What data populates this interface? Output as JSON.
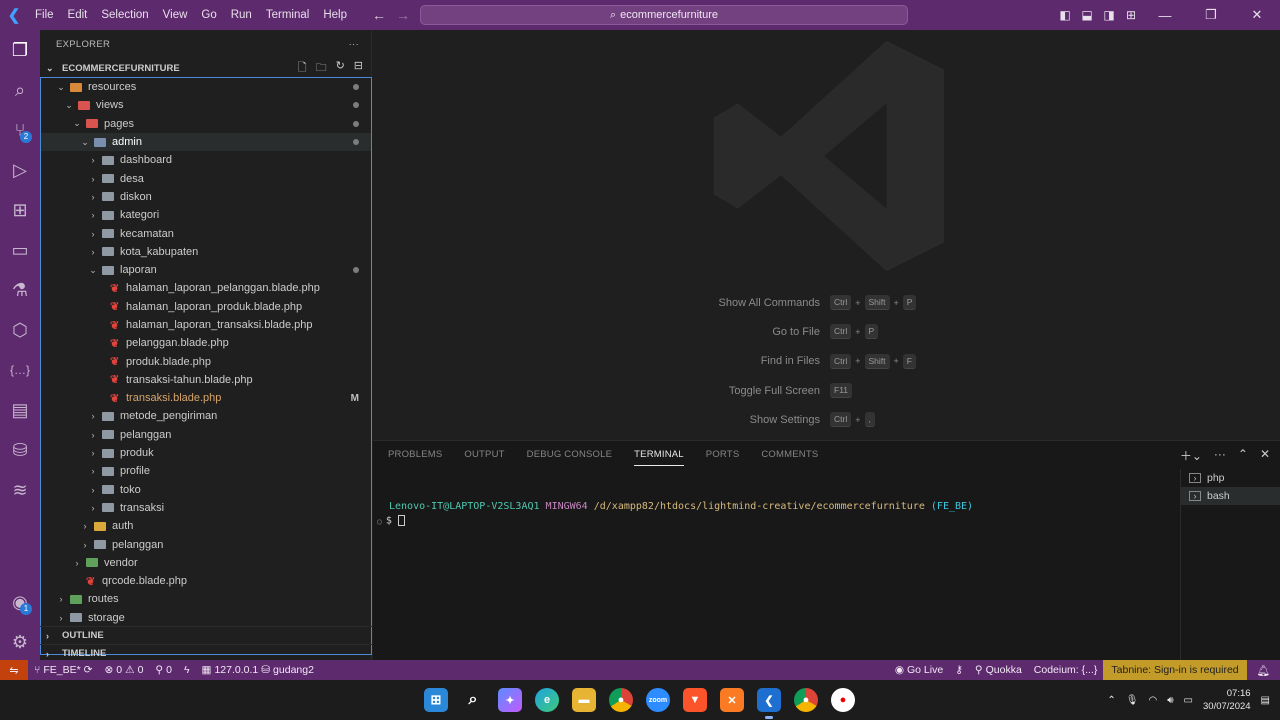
{
  "titlebar": {
    "menu": [
      "File",
      "Edit",
      "Selection",
      "View",
      "Go",
      "Run",
      "Terminal",
      "Help"
    ],
    "search_text": "ecommercefurniture"
  },
  "activity_bar": {
    "items": [
      {
        "name": "explorer-icon"
      },
      {
        "name": "search-icon"
      },
      {
        "name": "source-control-icon",
        "badge": "2"
      },
      {
        "name": "run-debug-icon"
      },
      {
        "name": "extensions-icon"
      },
      {
        "name": "remote-explorer-icon"
      },
      {
        "name": "testing-icon"
      },
      {
        "name": "deploy-icon"
      },
      {
        "name": "json-icon"
      },
      {
        "name": "browser-icon"
      },
      {
        "name": "database-icon"
      },
      {
        "name": "layers-icon"
      }
    ],
    "account_badge": "1"
  },
  "explorer": {
    "header": "EXPLORER",
    "root": "ECOMMERCEFURNITURE",
    "tree": [
      {
        "label": "resources",
        "depth": 1,
        "expanded": true,
        "icon": "orange",
        "dot": true
      },
      {
        "label": "views",
        "depth": 2,
        "expanded": true,
        "icon": "red",
        "dot": true
      },
      {
        "label": "pages",
        "depth": 3,
        "expanded": true,
        "icon": "red",
        "dot": true
      },
      {
        "label": "admin",
        "depth": 4,
        "expanded": true,
        "icon": "blue",
        "dot": true
      },
      {
        "label": "dashboard",
        "depth": 5,
        "expanded": false,
        "icon": "grey"
      },
      {
        "label": "desa",
        "depth": 5,
        "expanded": false,
        "icon": "grey"
      },
      {
        "label": "diskon",
        "depth": 5,
        "expanded": false,
        "icon": "grey"
      },
      {
        "label": "kategori",
        "depth": 5,
        "expanded": false,
        "icon": "grey"
      },
      {
        "label": "kecamatan",
        "depth": 5,
        "expanded": false,
        "icon": "grey"
      },
      {
        "label": "kota_kabupaten",
        "depth": 5,
        "expanded": false,
        "icon": "grey"
      },
      {
        "label": "laporan",
        "depth": 5,
        "expanded": true,
        "icon": "grey",
        "dot": true
      },
      {
        "label": "halaman_laporan_pelanggan.blade.php",
        "depth": 6,
        "file": true
      },
      {
        "label": "halaman_laporan_produk.blade.php",
        "depth": 6,
        "file": true
      },
      {
        "label": "halaman_laporan_transaksi.blade.php",
        "depth": 6,
        "file": true
      },
      {
        "label": "pelanggan.blade.php",
        "depth": 6,
        "file": true
      },
      {
        "label": "produk.blade.php",
        "depth": 6,
        "file": true
      },
      {
        "label": "transaksi-tahun.blade.php",
        "depth": 6,
        "file": true
      },
      {
        "label": "transaksi.blade.php",
        "depth": 6,
        "file": true,
        "mark": "M"
      },
      {
        "label": "metode_pengiriman",
        "depth": 5,
        "expanded": false,
        "icon": "grey"
      },
      {
        "label": "pelanggan",
        "depth": 5,
        "expanded": false,
        "icon": "grey"
      },
      {
        "label": "produk",
        "depth": 5,
        "expanded": false,
        "icon": "grey"
      },
      {
        "label": "profile",
        "depth": 5,
        "expanded": false,
        "icon": "grey"
      },
      {
        "label": "toko",
        "depth": 5,
        "expanded": false,
        "icon": "grey"
      },
      {
        "label": "transaksi",
        "depth": 5,
        "expanded": false,
        "icon": "grey"
      },
      {
        "label": "auth",
        "depth": 4,
        "expanded": false,
        "icon": "yellow"
      },
      {
        "label": "pelanggan",
        "depth": 4,
        "expanded": false,
        "icon": "grey"
      },
      {
        "label": "vendor",
        "depth": 3,
        "expanded": false,
        "icon": "green"
      },
      {
        "label": "qrcode.blade.php",
        "depth": 3,
        "file": true
      },
      {
        "label": "routes",
        "depth": 1,
        "expanded": false,
        "icon": "green"
      },
      {
        "label": "storage",
        "depth": 1,
        "expanded": false,
        "icon": "grey"
      }
    ],
    "outline": "OUTLINE",
    "timeline": "TIMELINE"
  },
  "welcome": {
    "shortcuts": [
      {
        "label": "Show All Commands",
        "keys": [
          "Ctrl",
          "Shift",
          "P"
        ]
      },
      {
        "label": "Go to File",
        "keys": [
          "Ctrl",
          "P"
        ]
      },
      {
        "label": "Find in Files",
        "keys": [
          "Ctrl",
          "Shift",
          "F"
        ]
      },
      {
        "label": "Toggle Full Screen",
        "keys": [
          "F11"
        ]
      },
      {
        "label": "Show Settings",
        "keys": [
          "Ctrl",
          ","
        ]
      }
    ]
  },
  "panel": {
    "tabs": [
      "PROBLEMS",
      "OUTPUT",
      "DEBUG CONSOLE",
      "TERMINAL",
      "PORTS",
      "COMMENTS"
    ],
    "active_tab": "TERMINAL",
    "prompt_user": "Lenovo-IT@LAPTOP-V2SL3AQ1",
    "prompt_env": "MINGW64",
    "prompt_path": "/d/xampp82/htdocs/lightmind-creative/ecommercefurniture",
    "prompt_branch": "(FE_BE)",
    "prompt_symbol": "$",
    "terminals": [
      "php",
      "bash"
    ]
  },
  "statusbar": {
    "branch": "FE_BE*",
    "errors": "0",
    "warnings": "0",
    "ports": "0",
    "host": "127.0.0.1",
    "db": "gudang2",
    "go_live": "Go Live",
    "quokka": "Quokka",
    "codeium": "Codeium: {...}",
    "tabnine": "Tabnine: Sign-in is required"
  },
  "taskbar": {
    "time": "07:16",
    "date": "30/07/2024"
  },
  "colors": {
    "accent_purple": "#5e2a6e",
    "editor_bg": "#1f1f1f",
    "warning_bg": "#c29b28"
  }
}
